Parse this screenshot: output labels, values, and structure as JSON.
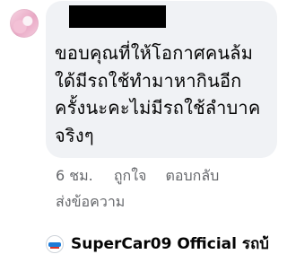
{
  "comment": {
    "lines": [
      "ขอบคุณที่ให้โอกาศคนล้ม",
      "ใด้มีรถใช้ทำมาหากินอีก",
      "ครั้งนะคะไม่มีรถใช้ลำบาค",
      "จริงๆ"
    ],
    "time": "6 ชม.",
    "like_label": "ถูกใจ",
    "reply_label": "ตอบกลับ",
    "send_message_label": "ส่งข้อความ"
  },
  "reply": {
    "page_name": "SuperCar09 Official รถบ้…"
  },
  "colors": {
    "bubble": "#f0f2f5",
    "meta_text": "#65676b",
    "text": "#050505"
  }
}
